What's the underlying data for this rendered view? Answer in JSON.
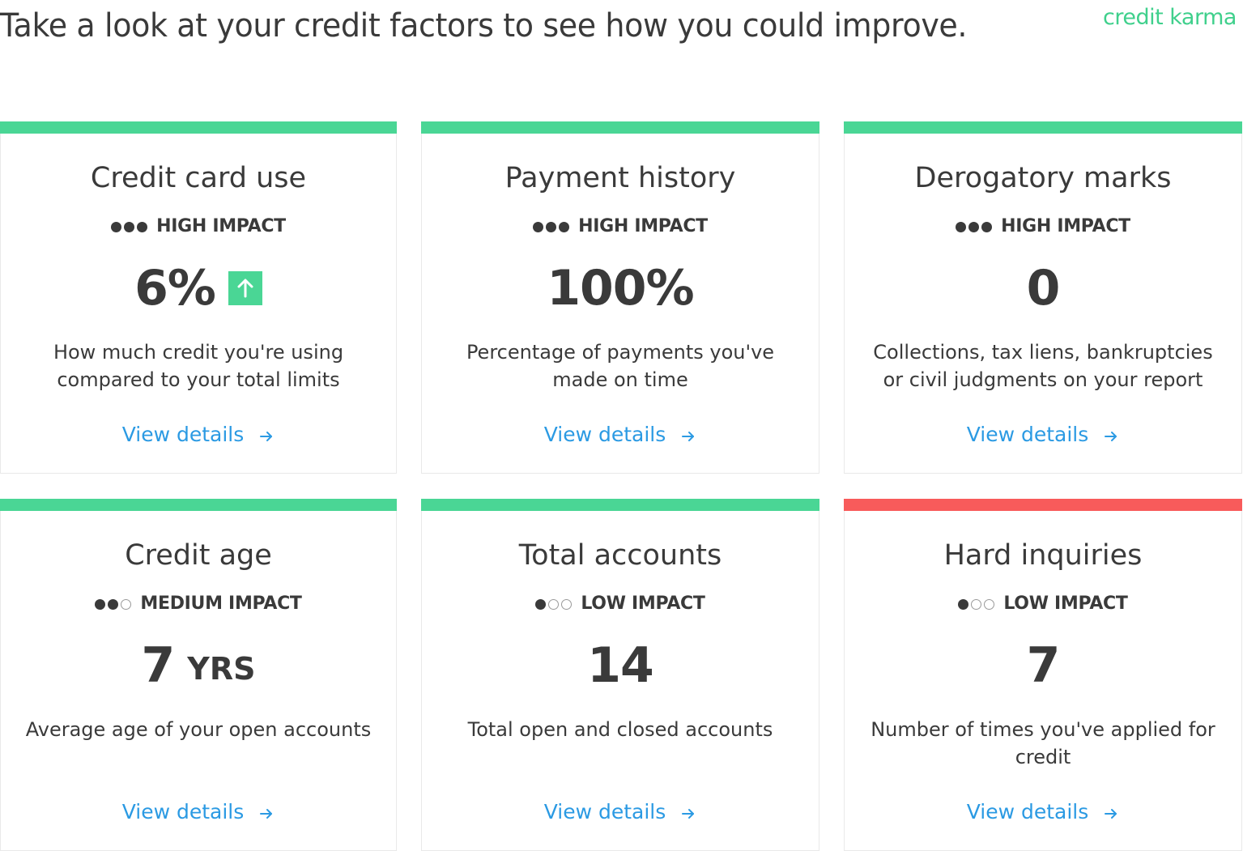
{
  "header": {
    "heading": "Take a look at your credit factors to see how you could improve.",
    "brand": "credit karma"
  },
  "colors": {
    "accent_good": "#4ad695",
    "accent_bad": "#f85b5b",
    "link": "#2b9ae3",
    "text": "#3a3a3a"
  },
  "cards": [
    {
      "title": "Credit card use",
      "impact_level": 3,
      "impact_label": "HIGH IMPACT",
      "value": "6%",
      "unit": "",
      "trend": "up",
      "trend_icon": "arrow-up-icon",
      "description": "How much credit you're using compared to your total limits",
      "link_label": "View details",
      "status": "good"
    },
    {
      "title": "Payment history",
      "impact_level": 3,
      "impact_label": "HIGH IMPACT",
      "value": "100%",
      "unit": "",
      "trend": "",
      "description": "Percentage of payments you've made on time",
      "link_label": "View details",
      "status": "good"
    },
    {
      "title": "Derogatory marks",
      "impact_level": 3,
      "impact_label": "HIGH IMPACT",
      "value": "0",
      "unit": "",
      "trend": "",
      "description": "Collections, tax liens, bankruptcies or civil judgments on your report",
      "link_label": "View details",
      "status": "good"
    },
    {
      "title": "Credit age",
      "impact_level": 2,
      "impact_label": "MEDIUM IMPACT",
      "value": "7",
      "unit": "YRS",
      "trend": "",
      "description": "Average age of your open accounts",
      "link_label": "View details",
      "status": "good"
    },
    {
      "title": "Total accounts",
      "impact_level": 1,
      "impact_label": "LOW IMPACT",
      "value": "14",
      "unit": "",
      "trend": "",
      "description": "Total open and closed accounts",
      "link_label": "View details",
      "status": "good"
    },
    {
      "title": "Hard inquiries",
      "impact_level": 1,
      "impact_label": "LOW IMPACT",
      "value": "7",
      "unit": "",
      "trend": "",
      "description": "Number of times you've applied for credit",
      "link_label": "View details",
      "status": "bad"
    }
  ]
}
